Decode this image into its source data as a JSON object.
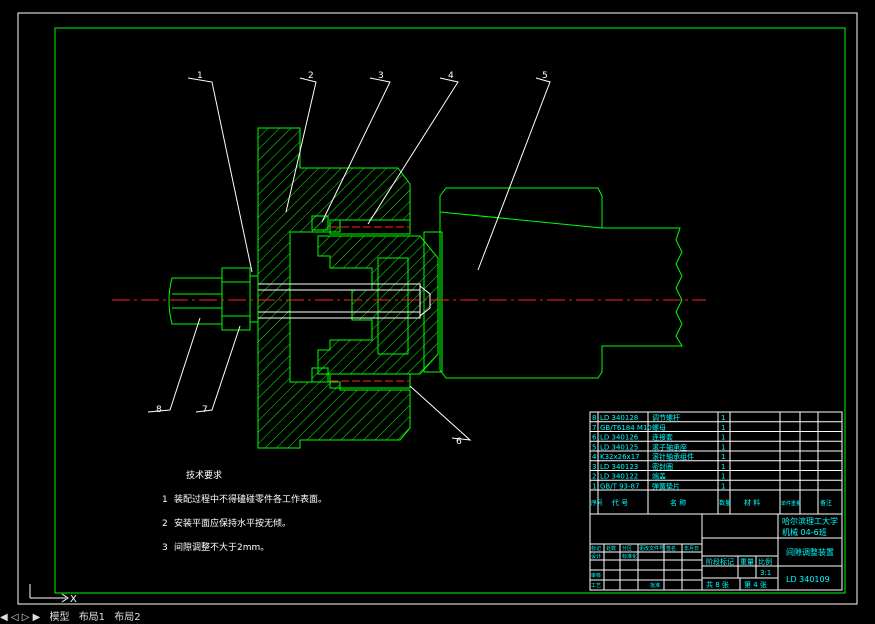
{
  "colors": {
    "background": "#000000",
    "frame": "#ffffff",
    "part_lines": "#00ff00",
    "hatch": "#00ff00",
    "center_line": "#ff2020",
    "bolt_lines": "#ffffff",
    "table_text": "#00ffff",
    "leader_lines": "#ffffff"
  },
  "part_labels": [
    "1",
    "2",
    "3",
    "4",
    "5",
    "6",
    "7",
    "8"
  ],
  "technical_requirements": {
    "title": "技术要求",
    "items": [
      {
        "num": "1",
        "text": "装配过程中不得磕碰零件各工作表面。"
      },
      {
        "num": "2",
        "text": "安装平面应保持水平按无倾。"
      },
      {
        "num": "3",
        "text": "间隙调整不大于2mm。"
      }
    ]
  },
  "parts_list": {
    "rows": [
      {
        "no": "8",
        "code": "LD 340128",
        "name": "调节螺杆",
        "qty": "1"
      },
      {
        "no": "7",
        "code": "GB/T6184 M10",
        "name": "螺母",
        "qty": "1"
      },
      {
        "no": "6",
        "code": "LD 340126",
        "name": "连接套",
        "qty": "1"
      },
      {
        "no": "5",
        "code": "LD 340125",
        "name": "滚子轴承座",
        "qty": "1"
      },
      {
        "no": "4",
        "code": "K32x26x17",
        "name": "滚针轴承组件",
        "qty": "1"
      },
      {
        "no": "3",
        "code": "LD 340123",
        "name": "密封圈",
        "qty": "1"
      },
      {
        "no": "2",
        "code": "LD 340122",
        "name": "端盖",
        "qty": "1"
      },
      {
        "no": "1",
        "code": "GB/T 93-87",
        "name": "弹簧垫片",
        "qty": "1"
      }
    ],
    "header": {
      "no": "序号",
      "code": "代 号",
      "name": "名 称",
      "qty": "数量",
      "material": "材 料",
      "unit_weight": "单件重量",
      "remark": "备注"
    }
  },
  "title_block": {
    "school": "哈尔滨理工大学",
    "class": "机械 04-6班",
    "drawing_name": "间隙调整装置",
    "drawing_number": "LD 340109",
    "scale_label": "比例",
    "scale": "3:1",
    "weight_label": "重量",
    "stage_label": "阶段标记",
    "sheets_total": "共 8 张",
    "sheet_current": "第 4 张",
    "row_labels": {
      "marker": "标记",
      "count": "处数",
      "zone": "分区",
      "change_doc": "更改文件号",
      "sign": "签名",
      "date": "年月日",
      "designer": "设计",
      "standard": "标准化",
      "check": "审核",
      "process": "工艺",
      "approve": "批准"
    }
  },
  "layout_tabs": [
    "模型",
    "布局1",
    "布局2"
  ]
}
